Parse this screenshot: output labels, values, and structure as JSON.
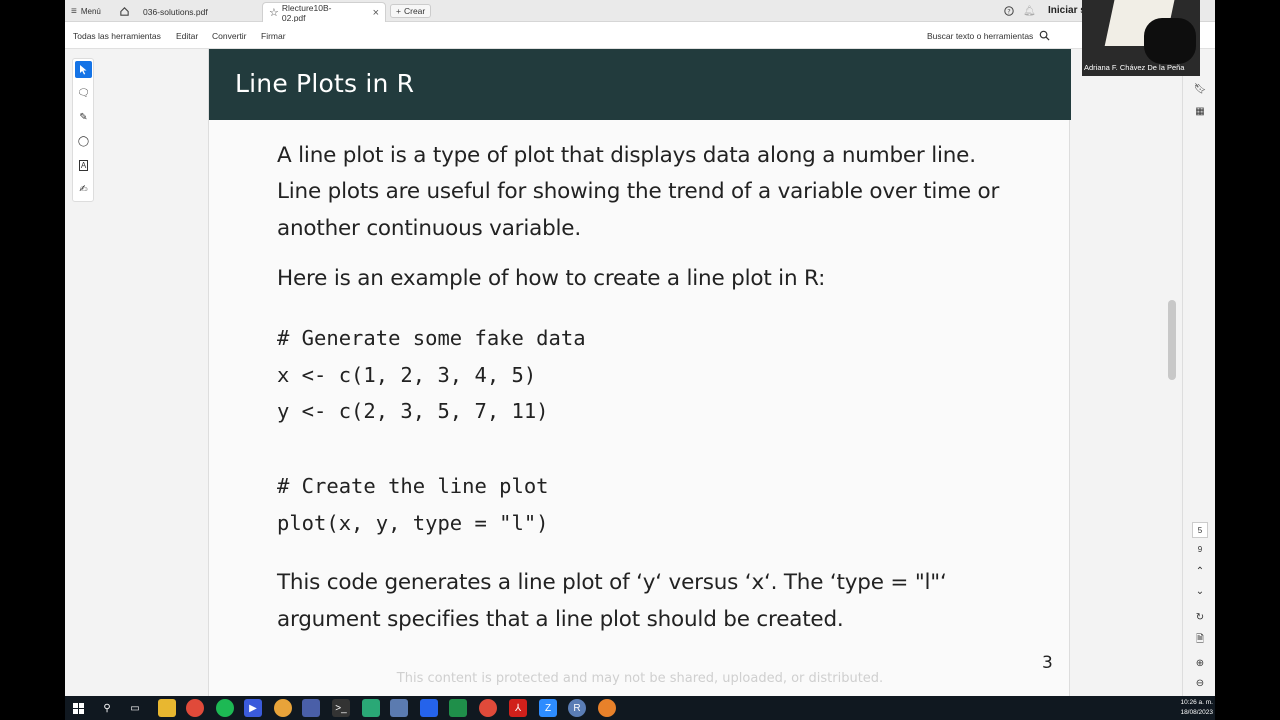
{
  "tabbar": {
    "menu_label": "Menú",
    "tabs": [
      {
        "label": "036-solutions.pdf"
      },
      {
        "label": "Rlecture10B-02.pdf"
      }
    ],
    "create_label": "Crear",
    "signin_label": "Iniciar s"
  },
  "toolbar": {
    "all_tools": "Todas las herramientas",
    "edit": "Editar",
    "convert": "Convertir",
    "sign": "Firmar",
    "search": "Buscar texto o herramientas"
  },
  "slide": {
    "title": "Line Plots in R",
    "para1": [
      "A line plot is a type of plot that displays data along a number line.",
      "Line plots are useful for showing the trend of a variable over time or",
      "another continuous variable."
    ],
    "para2": "Here is an example of how to create a line plot in R:",
    "code": [
      "# Generate some fake data",
      "x <- c(1, 2, 3, 4, 5)",
      "y <- c(2, 3, 5, 7, 11)",
      "# Create the line plot",
      "plot(x, y, type = \"l\")"
    ],
    "para3": [
      "This code generates a line plot of ‘y‘ versus ‘x‘. The ‘type = \"l\"‘",
      "argument specifies that a line plot should be created."
    ],
    "page_number": "3",
    "watermark": "This content is protected and may not be shared, uploaded, or distributed."
  },
  "rightpanel": {
    "page_current": "5",
    "page_total": "9"
  },
  "webcam": {
    "name": "Adriana F. Chávez De la Peña"
  },
  "taskbar": {
    "time": "10:26 a. m.",
    "date": "18/08/2023"
  },
  "colors": {
    "header_bg": "#223b3d",
    "accent": "#1473e6"
  }
}
